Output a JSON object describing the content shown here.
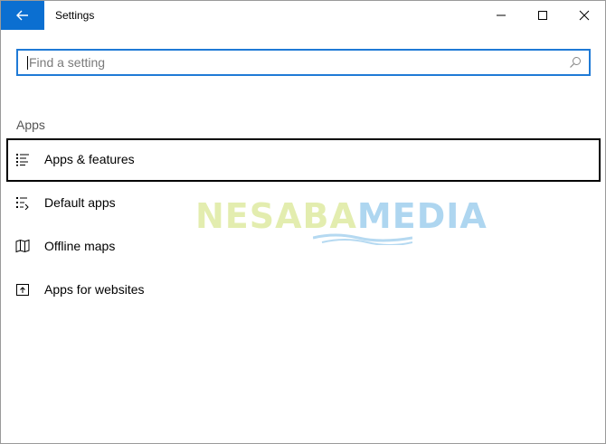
{
  "window": {
    "title": "Settings"
  },
  "icons": {
    "back": "back-arrow-icon",
    "minimize": "minimize-icon",
    "maximize": "maximize-icon",
    "close": "close-icon",
    "search": "search-icon"
  },
  "colors": {
    "accent": "#0b6fd1",
    "search_border": "#1f7ad6",
    "selected_border": "#000000"
  },
  "search": {
    "placeholder": "Find a setting",
    "value": ""
  },
  "section": {
    "title": "Apps"
  },
  "items": [
    {
      "label": "Apps & features",
      "icon": "apps-features-icon",
      "selected": true
    },
    {
      "label": "Default apps",
      "icon": "default-apps-icon",
      "selected": false
    },
    {
      "label": "Offline maps",
      "icon": "map-icon",
      "selected": false
    },
    {
      "label": "Apps for websites",
      "icon": "open-in-app-icon",
      "selected": false
    }
  ],
  "watermark": {
    "part1": "NESABA",
    "part2": "MEDIA"
  }
}
